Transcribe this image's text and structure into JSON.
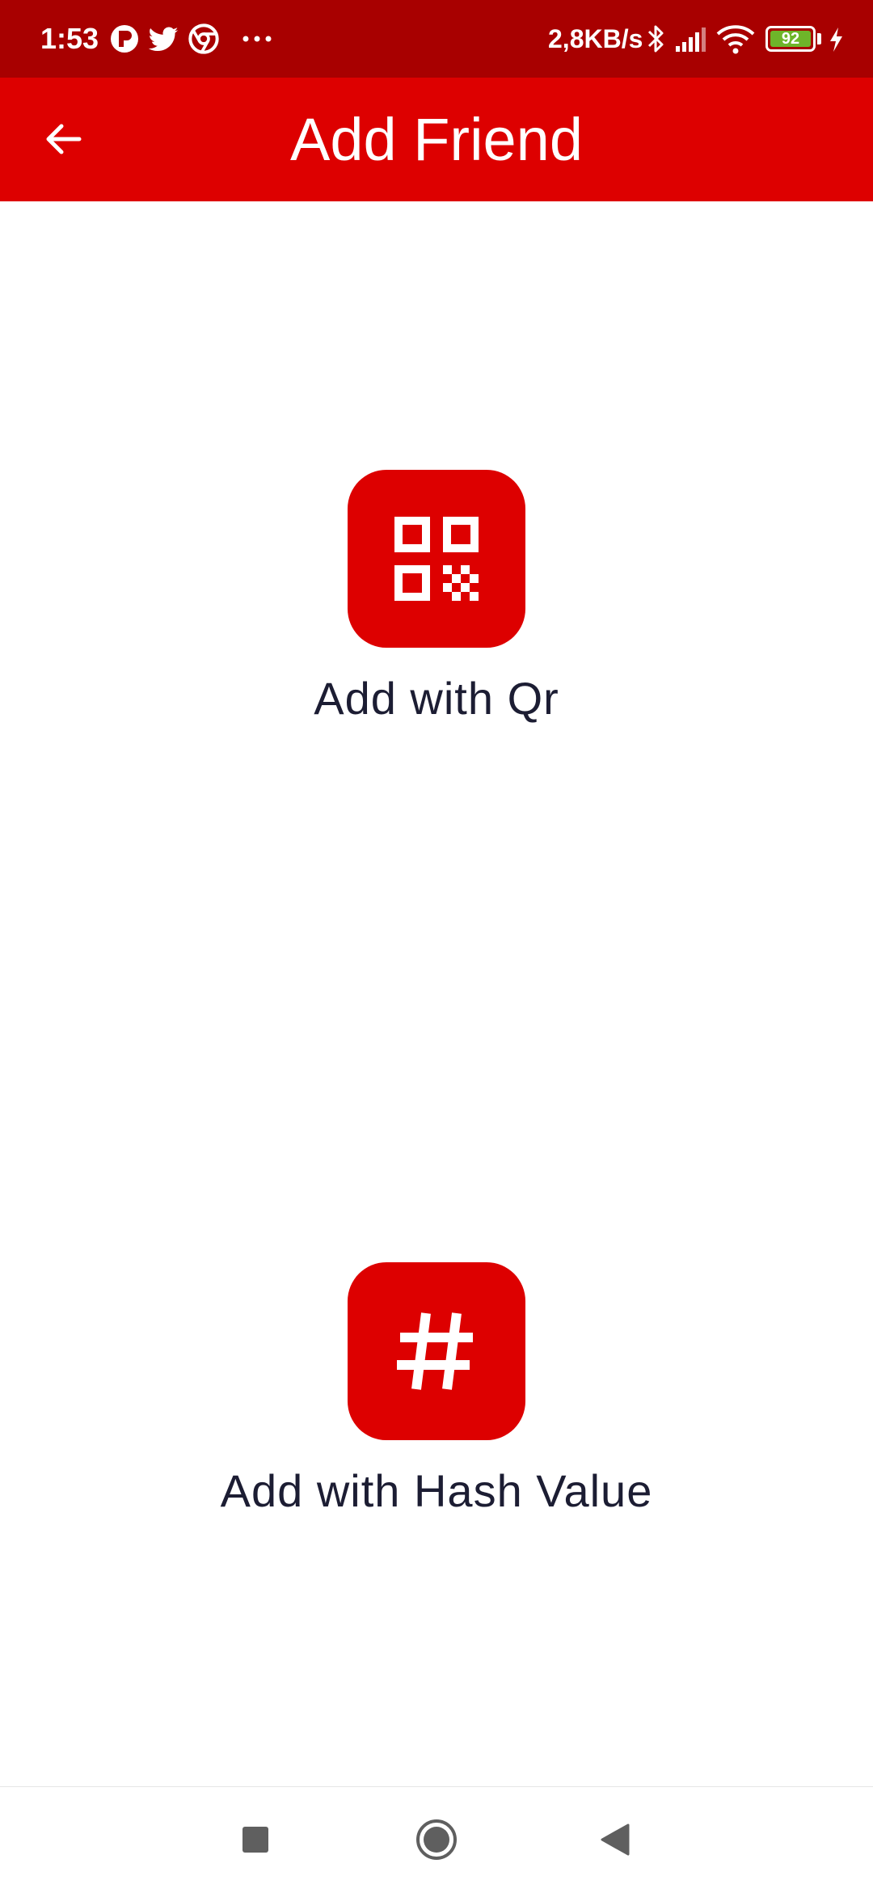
{
  "status_bar": {
    "time": "1:53",
    "network_speed": "2,8KB/s",
    "battery_level": "92",
    "icons": [
      "notification-app-icon",
      "twitter-icon",
      "chrome-icon",
      "more-notifications-icon",
      "bluetooth-icon",
      "signal-icon",
      "wifi-icon",
      "battery-icon",
      "charging-icon"
    ]
  },
  "app_bar": {
    "title": "Add Friend",
    "back_icon": "arrow-back-icon"
  },
  "options": [
    {
      "label": "Add with Qr",
      "icon": "qr-code-icon"
    },
    {
      "label": "Add with Hash Value",
      "icon": "hash-icon"
    }
  ],
  "nav_bar": {
    "icons": [
      "recents-square-icon",
      "home-circle-icon",
      "back-triangle-icon"
    ]
  },
  "colors": {
    "status_bar": "#a80000",
    "primary": "#dd0000",
    "label_text": "#1c1d33",
    "battery_fill": "#6eb52a"
  }
}
